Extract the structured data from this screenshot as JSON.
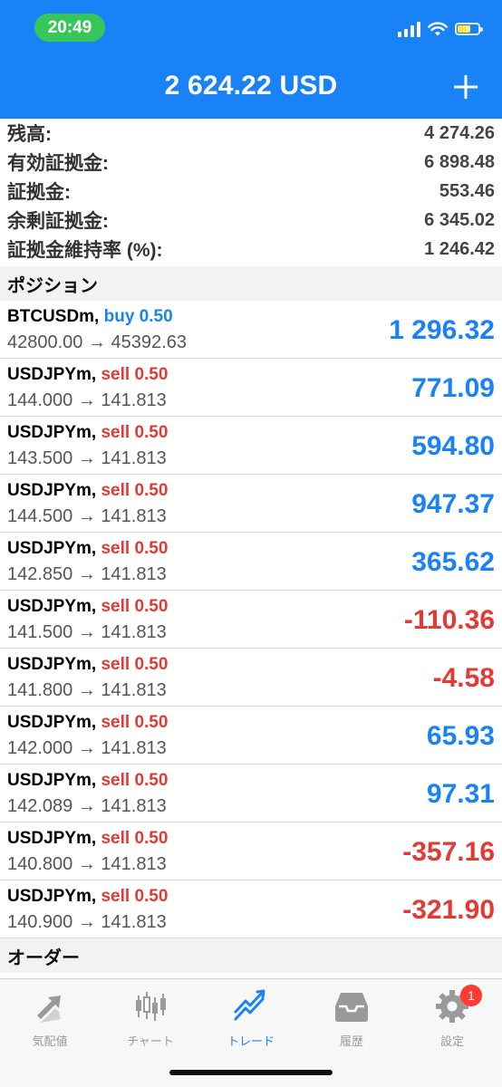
{
  "status": {
    "time": "20:49"
  },
  "header": {
    "equity": "2 624.22 USD",
    "add_label": "+"
  },
  "summary": [
    {
      "label": "残高:",
      "value": "4 274.26"
    },
    {
      "label": "有効証拠金:",
      "value": "6 898.48"
    },
    {
      "label": "証拠金:",
      "value": "553.46"
    },
    {
      "label": "余剰証拠金:",
      "value": "6 345.02"
    },
    {
      "label": "証拠金維持率 (%):",
      "value": "1 246.42"
    }
  ],
  "sections": {
    "positions": "ポジション",
    "orders": "オーダー"
  },
  "positions": [
    {
      "symbol": "BTCUSDm,",
      "side": "buy 0.50",
      "prices": "42800.00 → 45392.63",
      "profit": "1 296.32"
    },
    {
      "symbol": "USDJPYm,",
      "side": "sell 0.50",
      "prices": "144.000 → 141.813",
      "profit": "771.09"
    },
    {
      "symbol": "USDJPYm,",
      "side": "sell 0.50",
      "prices": "143.500 → 141.813",
      "profit": "594.80"
    },
    {
      "symbol": "USDJPYm,",
      "side": "sell 0.50",
      "prices": "144.500 → 141.813",
      "profit": "947.37"
    },
    {
      "symbol": "USDJPYm,",
      "side": "sell 0.50",
      "prices": "142.850 → 141.813",
      "profit": "365.62"
    },
    {
      "symbol": "USDJPYm,",
      "side": "sell 0.50",
      "prices": "141.500 → 141.813",
      "profit": "-110.36"
    },
    {
      "symbol": "USDJPYm,",
      "side": "sell 0.50",
      "prices": "141.800 → 141.813",
      "profit": "-4.58"
    },
    {
      "symbol": "USDJPYm,",
      "side": "sell 0.50",
      "prices": "142.000 → 141.813",
      "profit": "65.93"
    },
    {
      "symbol": "USDJPYm,",
      "side": "sell 0.50",
      "prices": "142.089 → 141.813",
      "profit": "97.31"
    },
    {
      "symbol": "USDJPYm,",
      "side": "sell 0.50",
      "prices": "140.800 → 141.813",
      "profit": "-357.16"
    },
    {
      "symbol": "USDJPYm,",
      "side": "sell 0.50",
      "prices": "140.900 → 141.813",
      "profit": "-321.90"
    }
  ],
  "tabs": [
    {
      "label": "気配値",
      "icon": "quotes-arrows-icon"
    },
    {
      "label": "チャート",
      "icon": "candlestick-chart-icon"
    },
    {
      "label": "トレード",
      "icon": "trade-trend-icon",
      "active": true
    },
    {
      "label": "履歴",
      "icon": "history-inbox-icon"
    },
    {
      "label": "設定",
      "icon": "settings-gear-icon",
      "badge": "1"
    }
  ],
  "colors": {
    "accent": "#1a82f7",
    "buy": "#1a82f7",
    "sell": "#e53935",
    "status_pill": "#35c759",
    "badge": "#ff3b30"
  }
}
